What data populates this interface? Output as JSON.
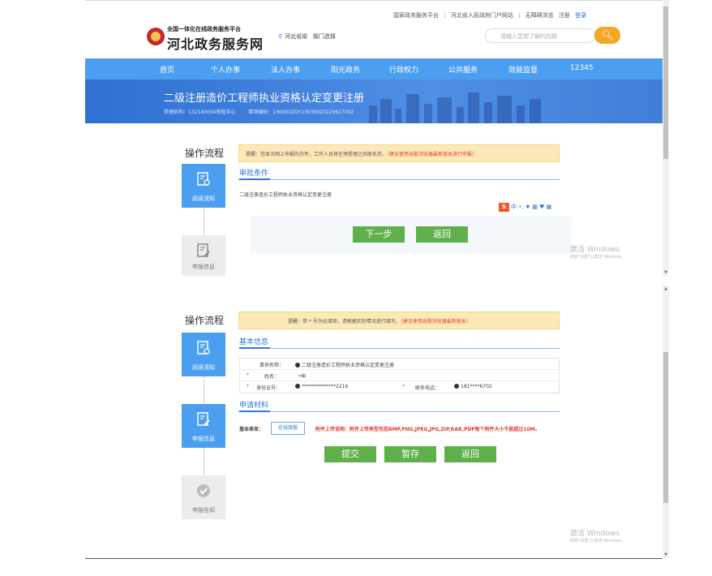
{
  "header": {
    "top_links": [
      "国家政务服务平台",
      "|",
      "河北省人民政府门户网站",
      "|",
      "无障碍浏览",
      "注册",
      "登录"
    ],
    "logo_sub": "全国一体化在线政务服务平台",
    "logo_main": "河北政务服务网",
    "location": "河北省级",
    "dept_select": "部门选择",
    "search_placeholder": "请输入您想了解的内容",
    "search_icon": "search-icon"
  },
  "nav": {
    "items": [
      "首页",
      "个人办事",
      "法人办事",
      "阳光政务",
      "行政权力",
      "公共服务",
      "效能监督",
      "12345"
    ]
  },
  "banner": {
    "title": "二级注册造价工程师执业资格认定变更注册",
    "agency": "受理机构：132140004审批中心",
    "code": "事项编码：130000ZDY13030020220627002"
  },
  "panel1": {
    "side_title": "操作流程",
    "steps": [
      "阅读须知",
      "申报信息"
    ],
    "notice": "提醒：您本次网上申报的办件，工作人员将在预受理之后联系您。",
    "notice_red": "（建议使用谷歌浏览器最新版本进行申报）",
    "section": "审批条件",
    "condition_text": "二级注册造价工程师执业资格认定变更注册",
    "ime_text": "中 •, ♦ ▦ ♥ ▦",
    "btn_next": "下一步",
    "btn_back": "返回",
    "watermark": "激活 Windows",
    "watermark_sub": "转到\"设置\"以激活 Windows。"
  },
  "panel2": {
    "side_title": "操作流程",
    "steps": [
      "阅读须知",
      "申报信息",
      "申报告知"
    ],
    "notice": "提醒：带 * 号为必填项，请根据实际情况进行填写。",
    "notice_red": "（建议使用谷歌浏览器最新版本）",
    "section_basic": "基本信息",
    "form": {
      "item_label": "事项名称：",
      "item_value": "二级注册造价工程师执业资格认定变更注册",
      "name_label": "姓名：",
      "name_value": "*坤",
      "id_label": "身份证号：",
      "id_value": "**************2216",
      "phone_label": "联系电话：",
      "phone_value": "181****6702",
      "star": "*"
    },
    "section_material": "申请材料",
    "basic_form_label": "基本表单：",
    "online_btn": "在线填报",
    "attach_note": "附件上传说明：附件上传类型包括BMP,PNG,JPEG,JPG,ZIP,RAR,PDF每个附件大小不能超过10M。",
    "btn_submit": "提交",
    "btn_save": "暂存",
    "btn_back": "返回",
    "watermark": "激活 Windows",
    "watermark_sub": "转到\"设置\"以激活 Windows。"
  },
  "colors": {
    "accent": "#4c9ff0",
    "green": "#5fb04a",
    "warn": "#fde9b8",
    "red": "#e23b2e"
  }
}
